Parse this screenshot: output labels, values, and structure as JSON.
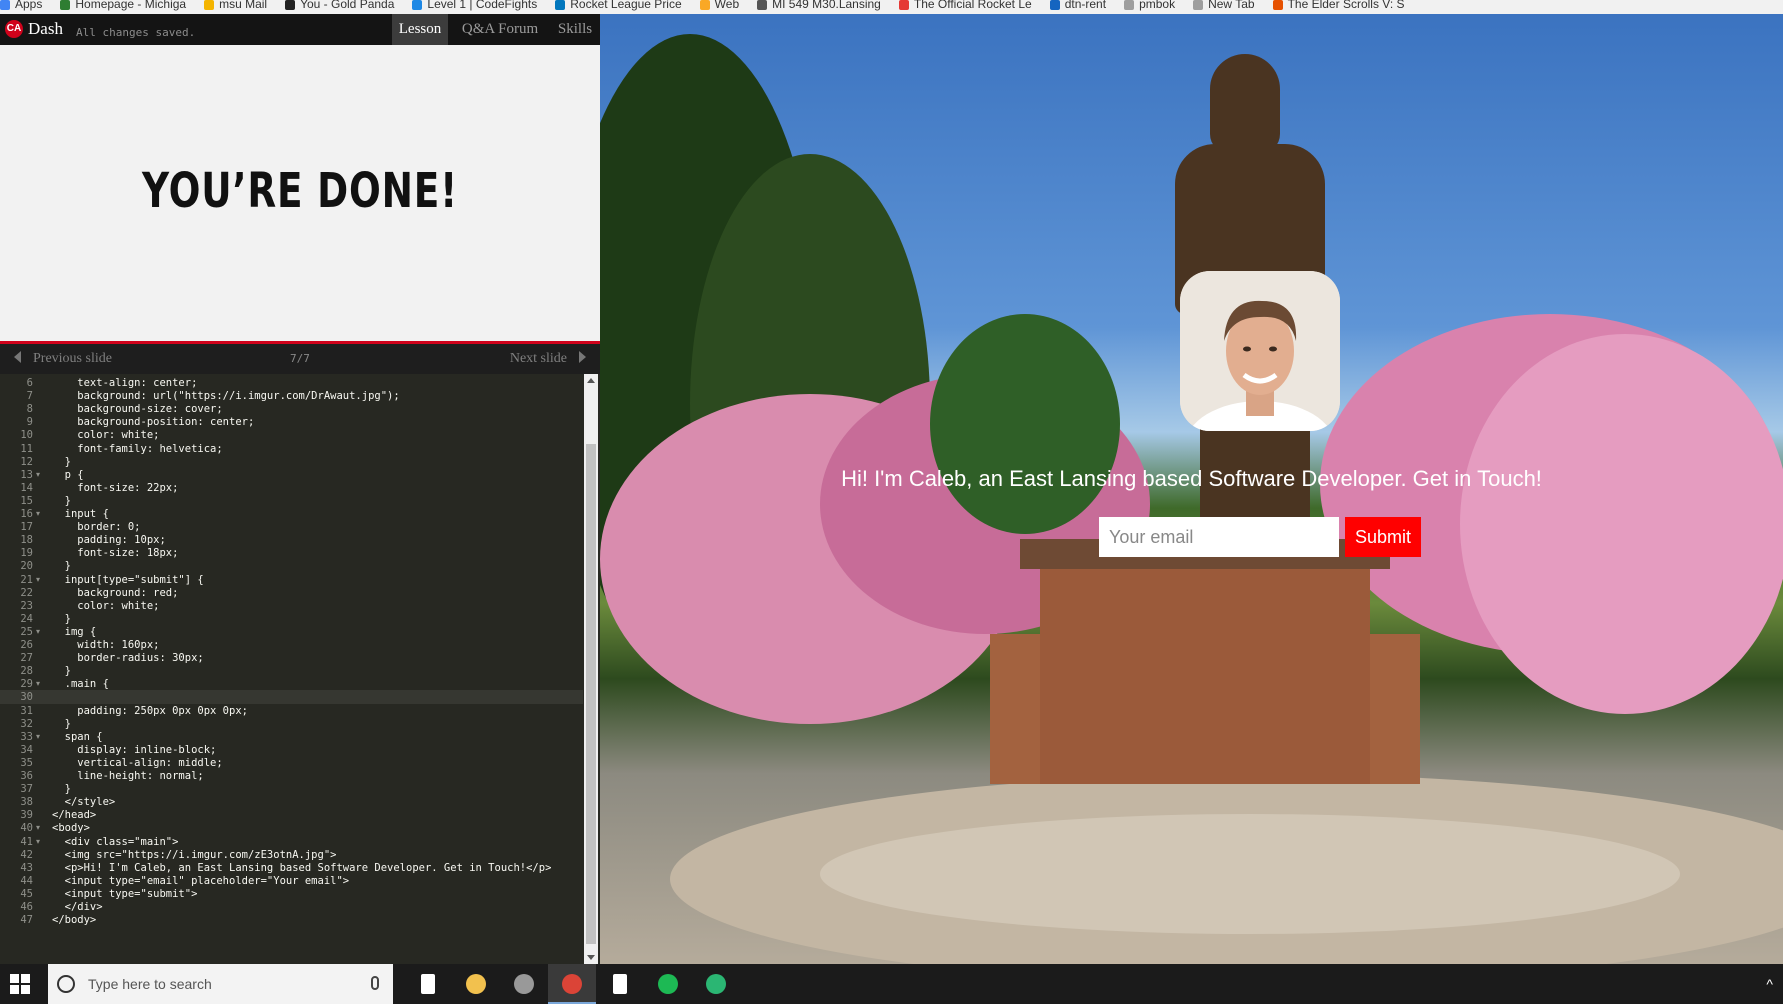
{
  "bookmarks": [
    {
      "label": "Apps",
      "color": "#4285f4"
    },
    {
      "label": "Homepage - Michiga",
      "color": "#2e7d32"
    },
    {
      "label": "msu Mail",
      "color": "#f4b400"
    },
    {
      "label": "You - Gold Panda",
      "color": "#222222"
    },
    {
      "label": "Level 1 | CodeFights",
      "color": "#1e88e5"
    },
    {
      "label": "Rocket League Price",
      "color": "#0277bd"
    },
    {
      "label": "Web",
      "color": "#f9a825"
    },
    {
      "label": "MI 549 M30.Lansing",
      "color": "#555555"
    },
    {
      "label": "The Official Rocket Le",
      "color": "#e53935"
    },
    {
      "label": "dtn-rent",
      "color": "#1565c0"
    },
    {
      "label": "pmbok",
      "color": "#9e9e9e"
    },
    {
      "label": "New Tab",
      "color": "#9e9e9e"
    },
    {
      "label": "The Elder Scrolls V: S",
      "color": "#e65100"
    }
  ],
  "topbar": {
    "logo": "CA",
    "app_name": "Dash",
    "saved_status": "All changes saved.",
    "tabs": [
      "Lesson",
      "Q&A Forum",
      "Skills"
    ]
  },
  "lesson": {
    "headline": "YOU’RE DONE!"
  },
  "slidenav": {
    "previous": "Previous slide",
    "next": "Next slide",
    "pager": "7/7"
  },
  "code_lines": [
    {
      "n": "6",
      "text": "    text-align: center;",
      "fold": ""
    },
    {
      "n": "7",
      "text": "    background: url(\"https://i.imgur.com/DrAwaut.jpg\");",
      "fold": ""
    },
    {
      "n": "8",
      "text": "    background-size: cover;",
      "fold": ""
    },
    {
      "n": "9",
      "text": "    background-position: center;",
      "fold": ""
    },
    {
      "n": "10",
      "text": "    color: white;",
      "fold": ""
    },
    {
      "n": "11",
      "text": "    font-family: helvetica;",
      "fold": ""
    },
    {
      "n": "12",
      "text": "  }",
      "fold": ""
    },
    {
      "n": "13",
      "text": "  p {",
      "fold": "▾"
    },
    {
      "n": "14",
      "text": "    font-size: 22px;",
      "fold": ""
    },
    {
      "n": "15",
      "text": "  }",
      "fold": ""
    },
    {
      "n": "16",
      "text": "  input {",
      "fold": "▾"
    },
    {
      "n": "17",
      "text": "    border: 0;",
      "fold": ""
    },
    {
      "n": "18",
      "text": "    padding: 10px;",
      "fold": ""
    },
    {
      "n": "19",
      "text": "    font-size: 18px;",
      "fold": ""
    },
    {
      "n": "20",
      "text": "  }",
      "fold": ""
    },
    {
      "n": "21",
      "text": "  input[type=\"submit\"] {",
      "fold": "▾"
    },
    {
      "n": "22",
      "text": "    background: red;",
      "fold": ""
    },
    {
      "n": "23",
      "text": "    color: white;",
      "fold": ""
    },
    {
      "n": "24",
      "text": "  }",
      "fold": ""
    },
    {
      "n": "25",
      "text": "  img {",
      "fold": "▾"
    },
    {
      "n": "26",
      "text": "    width: 160px;",
      "fold": ""
    },
    {
      "n": "27",
      "text": "    border-radius: 30px;",
      "fold": ""
    },
    {
      "n": "28",
      "text": "  }",
      "fold": ""
    },
    {
      "n": "29",
      "text": "  .main {",
      "fold": "▾"
    },
    {
      "n": "30",
      "text": "",
      "fold": ""
    },
    {
      "n": "31",
      "text": "    padding: 250px 0px 0px 0px;",
      "fold": ""
    },
    {
      "n": "32",
      "text": "  }",
      "fold": ""
    },
    {
      "n": "33",
      "text": "  span {",
      "fold": "▾"
    },
    {
      "n": "34",
      "text": "    display: inline-block;",
      "fold": ""
    },
    {
      "n": "35",
      "text": "    vertical-align: middle;",
      "fold": ""
    },
    {
      "n": "36",
      "text": "    line-height: normal;",
      "fold": ""
    },
    {
      "n": "37",
      "text": "  }",
      "fold": ""
    },
    {
      "n": "38",
      "text": "  </style>",
      "fold": ""
    },
    {
      "n": "39",
      "text": "</head>",
      "fold": ""
    },
    {
      "n": "40",
      "text": "<body>",
      "fold": "▾"
    },
    {
      "n": "41",
      "text": "  <div class=\"main\">",
      "fold": "▾"
    },
    {
      "n": "42",
      "text": "  <img src=\"https://i.imgur.com/zE3otnA.jpg\">",
      "fold": ""
    },
    {
      "n": "43",
      "text": "  <p>Hi! I'm Caleb, an East Lansing based Software Developer. Get in Touch!</p>",
      "fold": ""
    },
    {
      "n": "44",
      "text": "  <input type=\"email\" placeholder=\"Your email\">",
      "fold": ""
    },
    {
      "n": "45",
      "text": "  <input type=\"submit\">",
      "fold": ""
    },
    {
      "n": "46",
      "text": "  </div>",
      "fold": ""
    },
    {
      "n": "47",
      "text": "</body>",
      "fold": ""
    }
  ],
  "active_line": "30",
  "preview": {
    "tagline": "Hi! I'm Caleb, an East Lansing based Software Developer. Get in Touch!",
    "email_placeholder": "Your email",
    "submit_label": "Submit"
  },
  "taskbar": {
    "search_placeholder": "Type here to search",
    "apps": [
      {
        "name": "task-view",
        "color": "#ffffff"
      },
      {
        "name": "file-explorer",
        "color": "#f2c14e"
      },
      {
        "name": "obs",
        "color": "#999999"
      },
      {
        "name": "chrome",
        "color": "#db4437"
      },
      {
        "name": "file",
        "color": "#ffffff"
      },
      {
        "name": "spotify",
        "color": "#1db954"
      },
      {
        "name": "app-green",
        "color": "#2bb673"
      }
    ],
    "tray": "^"
  }
}
